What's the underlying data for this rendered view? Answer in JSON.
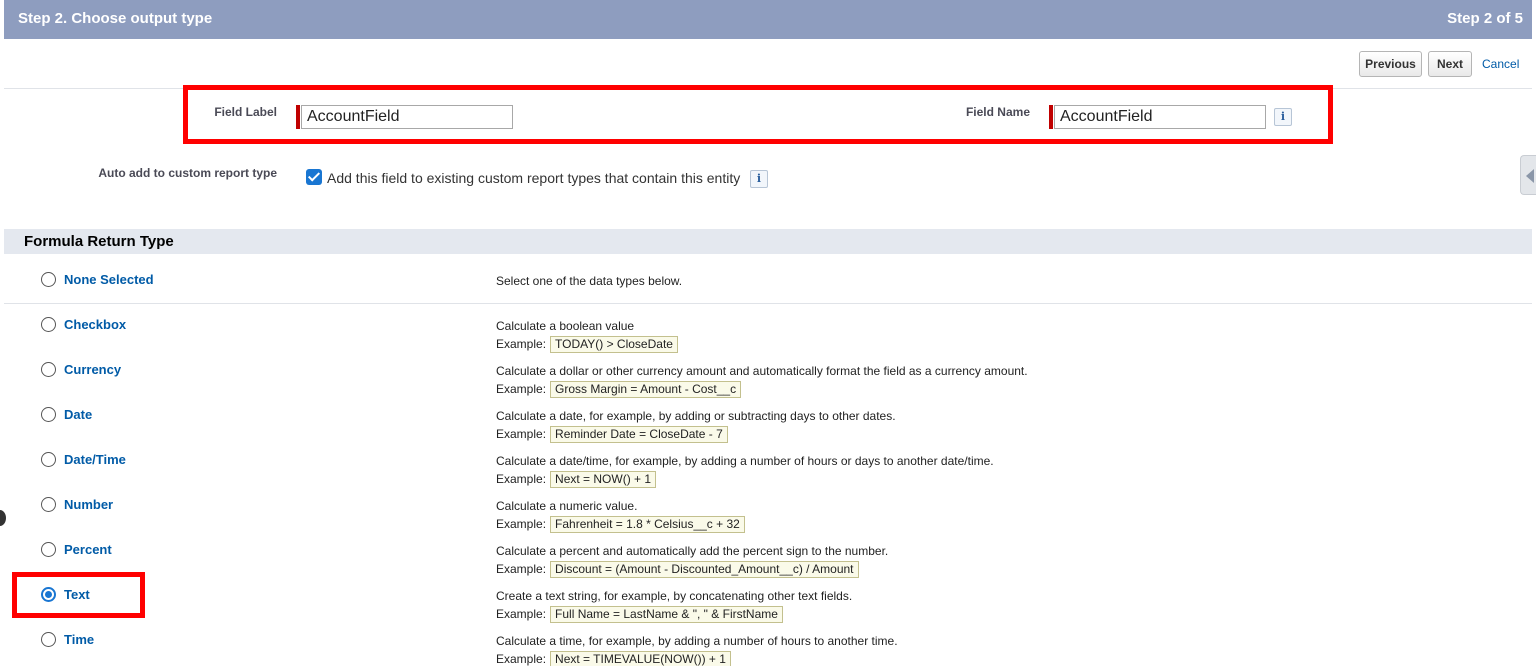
{
  "header": {
    "title": "Step 2. Choose output type",
    "step": "Step 2 of 5"
  },
  "buttons": {
    "previous": "Previous",
    "next": "Next",
    "cancel": "Cancel"
  },
  "fields": {
    "field_label": {
      "label": "Field Label",
      "value": "AccountField"
    },
    "field_name": {
      "label": "Field Name",
      "value": "AccountField"
    },
    "info_glyph": "i",
    "auto_add": {
      "label": "Auto add to custom report type",
      "checkbox_text": "Add this field to existing custom report types that contain this entity",
      "checked": true
    }
  },
  "section": {
    "title": "Formula Return Type"
  },
  "example_prefix": "Example:",
  "types": [
    {
      "name": "None Selected",
      "description": "Select one of the data types below.",
      "example": "",
      "selected": false
    },
    {
      "name": "Checkbox",
      "description": "Calculate a boolean value",
      "example": "TODAY() > CloseDate",
      "selected": false
    },
    {
      "name": "Currency",
      "description": "Calculate a dollar or other currency amount and automatically format the field as a currency amount.",
      "example": "Gross Margin = Amount - Cost__c",
      "selected": false
    },
    {
      "name": "Date",
      "description": "Calculate a date, for example, by adding or subtracting days to other dates.",
      "example": "Reminder Date = CloseDate - 7",
      "selected": false
    },
    {
      "name": "Date/Time",
      "description": "Calculate a date/time, for example, by adding a number of hours or days to another date/time.",
      "example": "Next = NOW() + 1",
      "selected": false
    },
    {
      "name": "Number",
      "description": "Calculate a numeric value.",
      "example": "Fahrenheit = 1.8 * Celsius__c + 32",
      "selected": false
    },
    {
      "name": "Percent",
      "description": "Calculate a percent and automatically add the percent sign to the number.",
      "example": "Discount = (Amount - Discounted_Amount__c) / Amount",
      "selected": false
    },
    {
      "name": "Text",
      "description": "Create a text string, for example, by concatenating other text fields.",
      "example": "Full Name = LastName & \", \" & FirstName",
      "selected": true
    },
    {
      "name": "Time",
      "description": "Calculate a time, for example, by adding a number of hours to another time.",
      "example": "Next = TIMEVALUE(NOW()) + 1",
      "selected": false
    }
  ],
  "colors": {
    "header_bg": "#8e9dbf",
    "link": "#015ba7",
    "highlight": "#ff0000",
    "accent": "#1976d2"
  }
}
